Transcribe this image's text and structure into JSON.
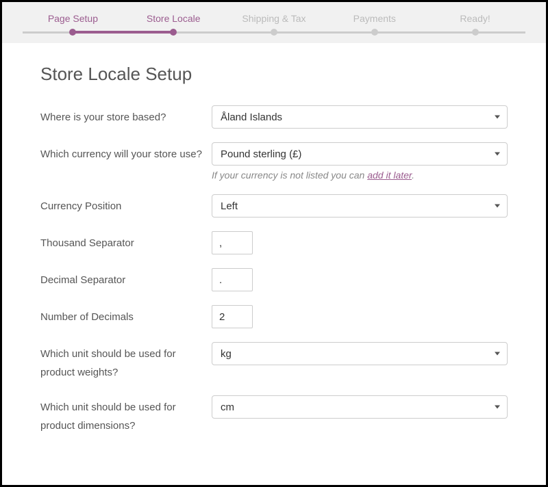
{
  "wizard": {
    "steps": [
      {
        "label": "Page Setup",
        "state": "done"
      },
      {
        "label": "Store Locale",
        "state": "active"
      },
      {
        "label": "Shipping & Tax",
        "state": "pending"
      },
      {
        "label": "Payments",
        "state": "pending"
      },
      {
        "label": "Ready!",
        "state": "pending"
      }
    ]
  },
  "page": {
    "title": "Store Locale Setup"
  },
  "fields": {
    "store_base": {
      "label": "Where is your store based?",
      "value": "Åland Islands"
    },
    "currency": {
      "label": "Which currency will your store use?",
      "value": "Pound sterling (£)",
      "help_prefix": "If your currency is not listed you can ",
      "help_link": "add it later",
      "help_suffix": "."
    },
    "currency_position": {
      "label": "Currency Position",
      "value": "Left"
    },
    "thousand_sep": {
      "label": "Thousand Separator",
      "value": ","
    },
    "decimal_sep": {
      "label": "Decimal Separator",
      "value": "."
    },
    "num_decimals": {
      "label": "Number of Decimals",
      "value": "2"
    },
    "weight_unit": {
      "label": "Which unit should be used for product weights?",
      "value": "kg"
    },
    "dimension_unit": {
      "label": "Which unit should be used for product dimensions?",
      "value": "cm"
    }
  }
}
